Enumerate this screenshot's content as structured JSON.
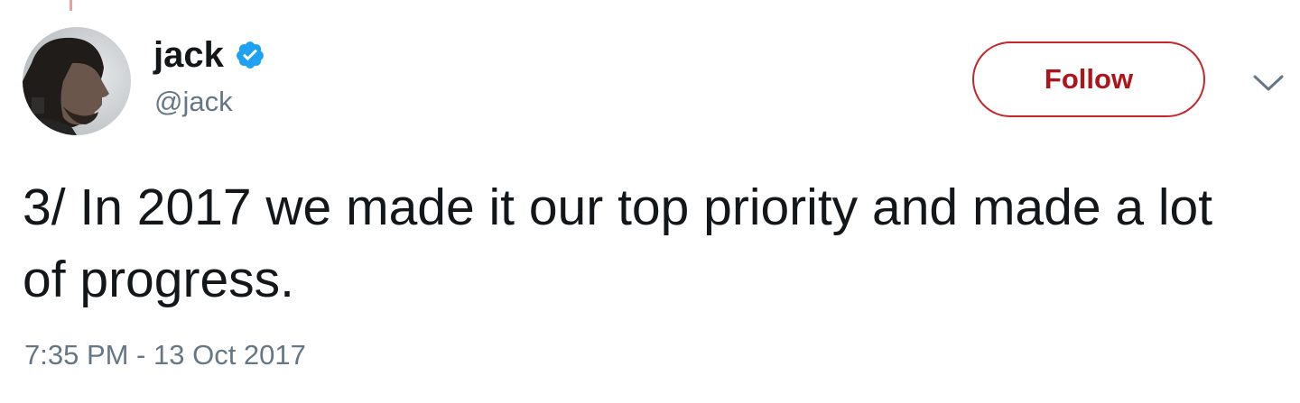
{
  "tweet": {
    "author": {
      "display_name": "jack",
      "handle": "@jack",
      "verified": true,
      "avatar_icon": "user-avatar"
    },
    "follow_label": "Follow",
    "menu_icon": "chevron-down-icon",
    "text": "3/ In 2017 we made it our top priority and made a lot of progress.",
    "timestamp": "7:35 PM - 13 Oct 2017"
  },
  "colors": {
    "follow_accent": "#b0141b",
    "verified_badge": "#1da1f2",
    "secondary_text": "#657786",
    "primary_text": "#14171a"
  }
}
